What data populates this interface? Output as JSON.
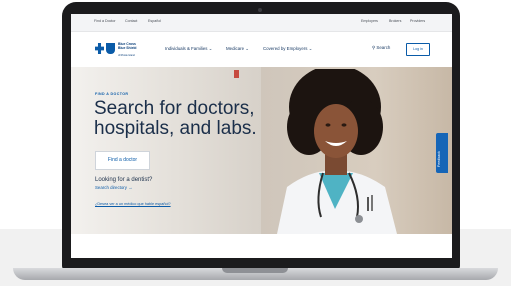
{
  "utility": {
    "links": [
      "Find a Doctor",
      "Contact",
      "Español"
    ],
    "right_links": [
      "Employers",
      "Brokers",
      "Providers"
    ]
  },
  "header": {
    "logo_line1": "Blue Cross",
    "logo_line2": "Blue Shield",
    "logo_sub": "of Rhode Island",
    "nav": [
      "Individuals & Families ⌄",
      "Medicare ⌄",
      "Covered by Employers ⌄"
    ],
    "search": "⚲ Search",
    "login": "Log in"
  },
  "hero": {
    "eyebrow": "FIND A DOCTOR",
    "headline": "Search for doctors, hospitals, and labs.",
    "find_button": "Find a doctor",
    "dentist_label": "Looking for a dentist?",
    "search_directory": "Search directory →",
    "spanish_link": "¿Desea ver a un médico que hable español?"
  },
  "feedback": "Feedback",
  "colors": {
    "brand_blue": "#0a5ba8",
    "navy": "#1b2f4a",
    "feedback": "#1565b7"
  }
}
